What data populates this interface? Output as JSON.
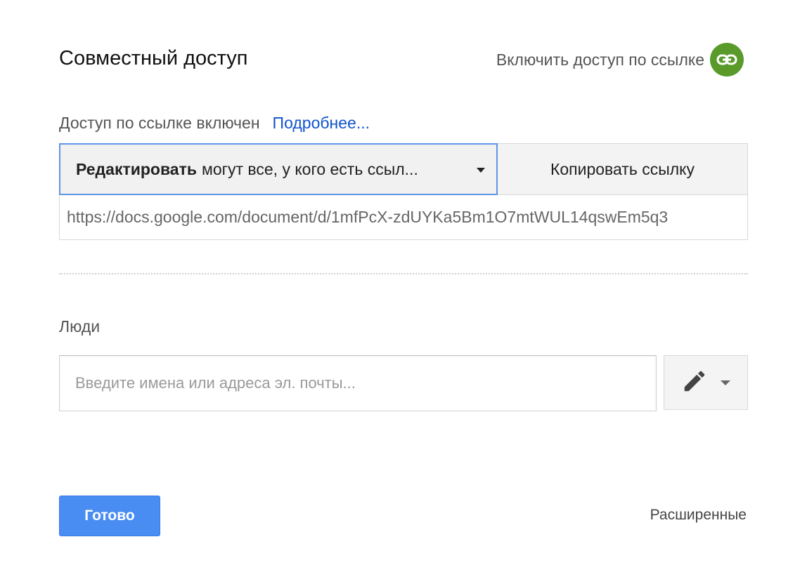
{
  "dialog": {
    "title": "Совместный доступ",
    "link_toggle_label": "Включить доступ по ссылке",
    "link_toggle_icon": "link-icon",
    "accent_green": "#5a9a2b"
  },
  "link_sharing": {
    "status": "Доступ по ссылке включен",
    "learn_more": "Подробнее...",
    "permission_bold": "Редактировать",
    "permission_rest": "могут все, у кого есть ссыл...",
    "copy_button": "Копировать ссылку",
    "url": "https://docs.google.com/document/d/1mfPcX-zdUYKa5Bm1O7mtWUL14qswEm5q3"
  },
  "people": {
    "label": "Люди",
    "input_placeholder": "Введите имена или адреса эл. почты...",
    "input_value": "",
    "permission_icon": "pencil-icon"
  },
  "footer": {
    "done_button": "Готово",
    "advanced_link": "Расширенные",
    "primary_blue": "#4a8df2"
  }
}
